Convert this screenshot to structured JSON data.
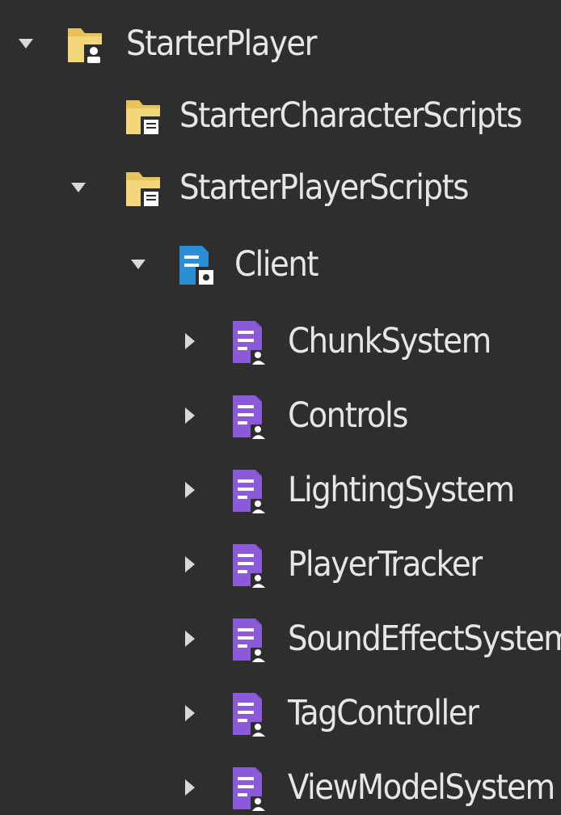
{
  "tree": {
    "items": [
      {
        "label": "StarterPlayer",
        "level": 0,
        "icon": "folder-player-icon",
        "arrow": "expanded"
      },
      {
        "label": "StarterCharacterScripts",
        "level": 1,
        "icon": "folder-script-icon",
        "arrow": "none"
      },
      {
        "label": "StarterPlayerScripts",
        "level": 1,
        "icon": "folder-script-icon",
        "arrow": "expanded"
      },
      {
        "label": "Client",
        "level": 2,
        "icon": "local-script-icon",
        "arrow": "expanded"
      },
      {
        "label": "ChunkSystem",
        "level": 3,
        "icon": "module-script-icon",
        "arrow": "collapsed"
      },
      {
        "label": "Controls",
        "level": 3,
        "icon": "module-script-icon",
        "arrow": "collapsed"
      },
      {
        "label": "LightingSystem",
        "level": 3,
        "icon": "module-script-icon",
        "arrow": "collapsed"
      },
      {
        "label": "PlayerTracker",
        "level": 3,
        "icon": "module-script-icon",
        "arrow": "collapsed"
      },
      {
        "label": "SoundEffectSystem",
        "level": 3,
        "icon": "module-script-icon",
        "arrow": "collapsed"
      },
      {
        "label": "TagController",
        "level": 3,
        "icon": "module-script-icon",
        "arrow": "collapsed"
      },
      {
        "label": "ViewModelSystem",
        "level": 3,
        "icon": "module-script-icon",
        "arrow": "collapsed"
      }
    ]
  },
  "colors": {
    "background": "#2e2e2e",
    "text": "#e6e6e6",
    "folder": "#e8c25a",
    "local_script": "#2b8fd6",
    "module_script": "#8b5ad8"
  }
}
